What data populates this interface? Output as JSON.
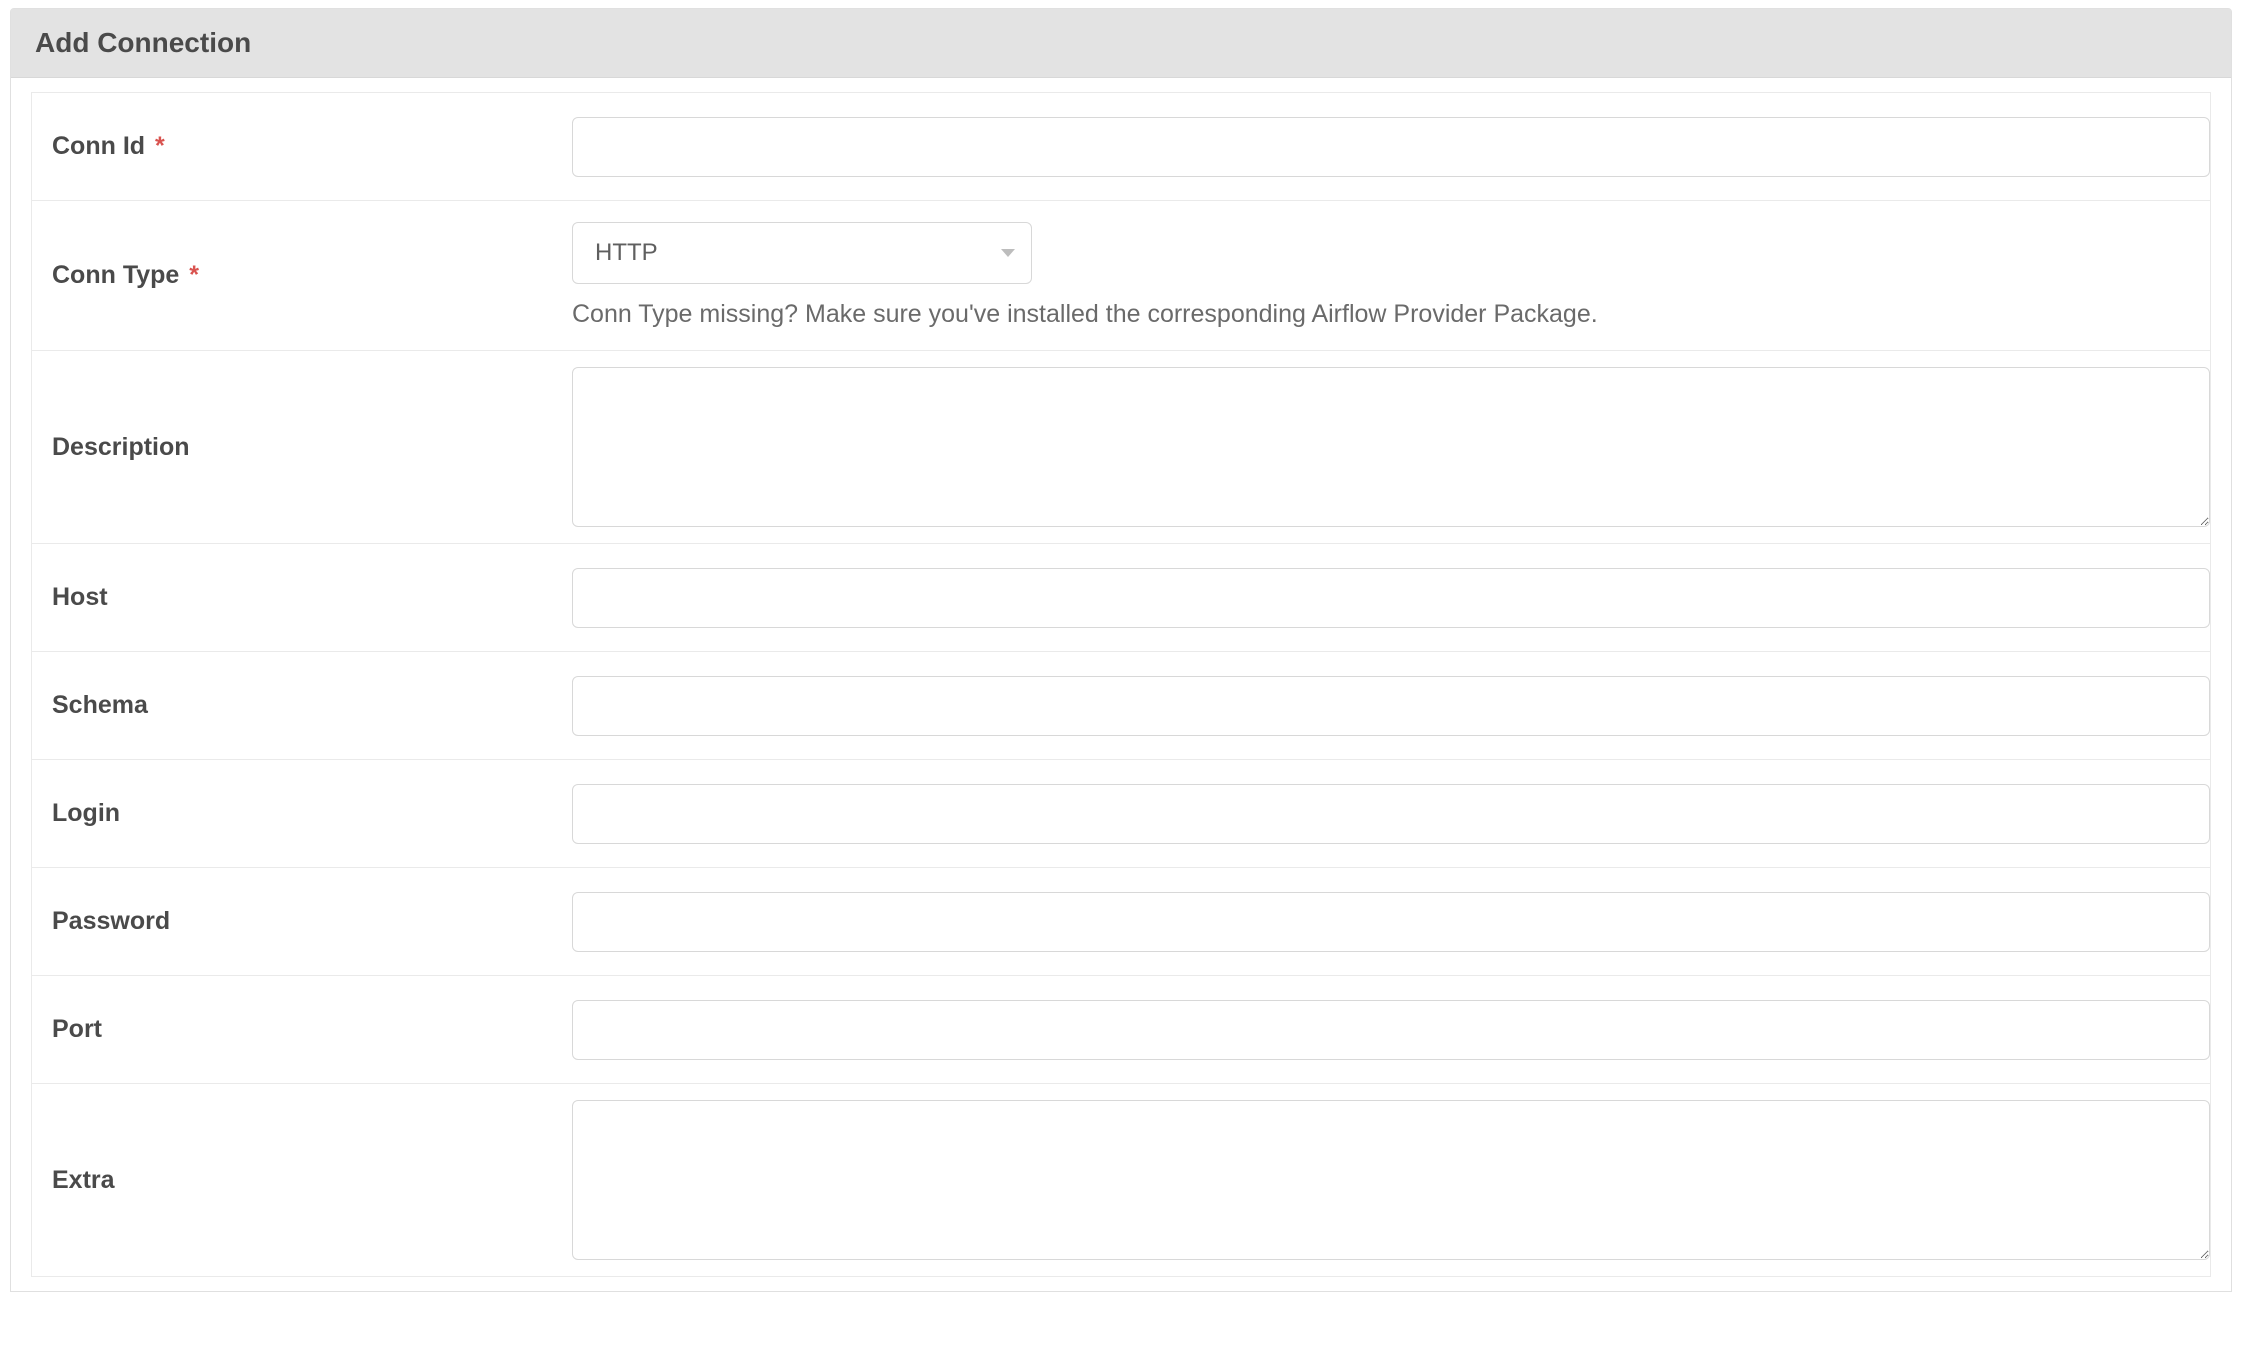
{
  "header": {
    "title": "Add Connection"
  },
  "form": {
    "conn_id": {
      "label": "Conn Id",
      "required": true,
      "value": ""
    },
    "conn_type": {
      "label": "Conn Type",
      "required": true,
      "selected": "HTTP",
      "help": "Conn Type missing? Make sure you've installed the corresponding Airflow Provider Package."
    },
    "description": {
      "label": "Description",
      "value": ""
    },
    "host": {
      "label": "Host",
      "value": ""
    },
    "schema": {
      "label": "Schema",
      "value": ""
    },
    "login": {
      "label": "Login",
      "value": ""
    },
    "password": {
      "label": "Password",
      "value": ""
    },
    "port": {
      "label": "Port",
      "value": ""
    },
    "extra": {
      "label": "Extra",
      "value": ""
    }
  },
  "required_marker": "*"
}
